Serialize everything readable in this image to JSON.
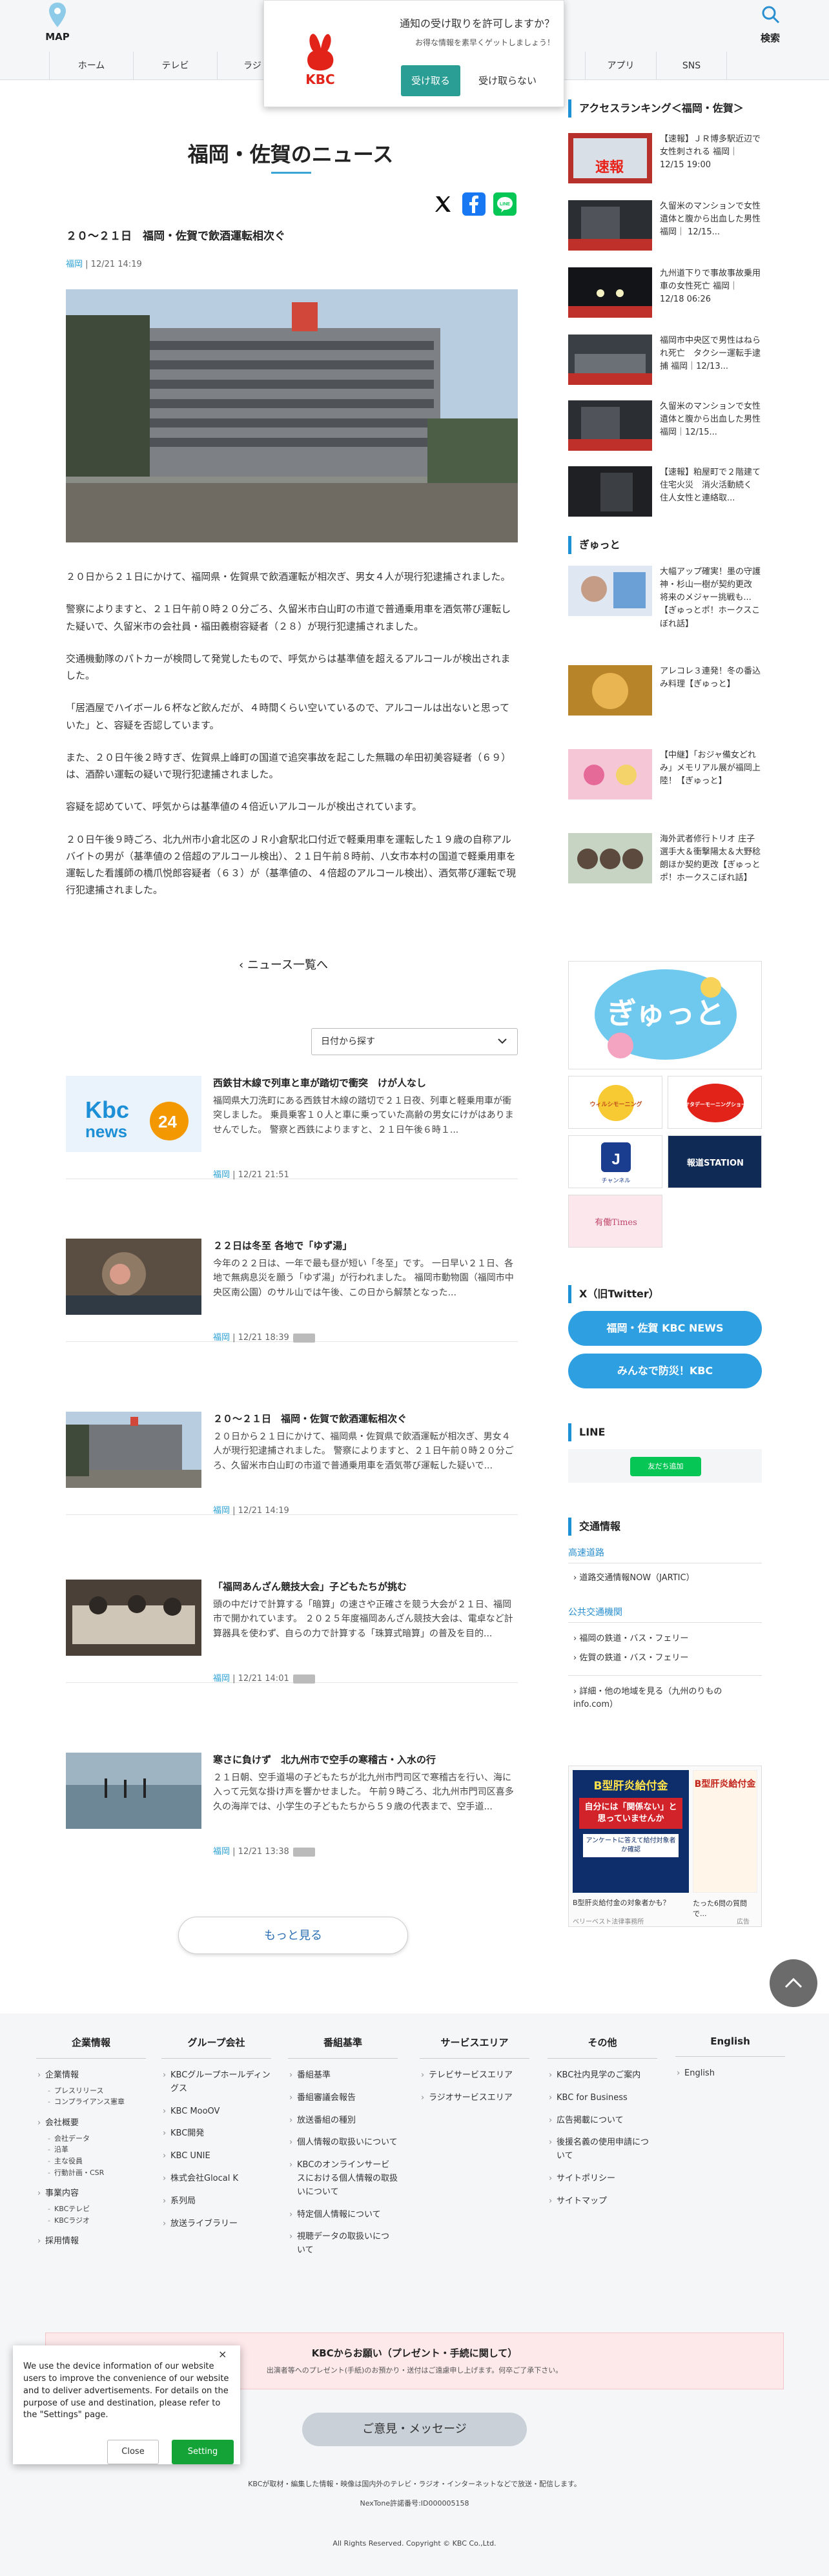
{
  "header": {
    "map_label": "MAP",
    "search_label": "検索",
    "nav": [
      "ホーム",
      "テレビ",
      "ラジ",
      "",
      "",
      "",
      "",
      "ベント",
      "アプリ",
      "SNS"
    ]
  },
  "notify": {
    "question": "通知の受け取りを許可しますか？",
    "sub": "お得な情報を素早くゲットしましょう！",
    "accept": "受け取る",
    "deny": "受け取らない",
    "logo_text": "KBC"
  },
  "main": {
    "section_title": "福岡・佐賀のニュース",
    "article": {
      "title": "２０～２１日　福岡・佐賀で飲酒運転相次ぐ",
      "tag": "福岡",
      "date": "12/21 14:19",
      "body": [
        "２０日から２１日にかけて、福岡県・佐賀県で飲酒運転が相次ぎ、男女４人が現行犯逮捕されました。",
        "警察によりますと、２１日午前０時２０分ごろ、久留米市白山町の市道で普通乗用車を酒気帯び運転した疑いで、久留米市の会社員・福田義樹容疑者（２８）が現行犯逮捕されました。",
        "交通機動隊のパトカーが検問して発覚したもので、呼気からは基準値を超えるアルコールが検出されました。",
        "「居酒屋でハイボール６杯など飲んだが、４時間くらい空いているので、アルコールは出ないと思っていた」と、容疑を否認しています。",
        "また、２０日午後２時すぎ、佐賀県上峰町の国道で追突事故を起こした無職の牟田初美容疑者（６９）は、酒酔い運転の疑いで現行犯逮捕されました。",
        "容疑を認めていて、呼気からは基準値の４倍近いアルコールが検出されています。",
        "２０日午後９時ごろ、北九州市小倉北区のＪＲ小倉駅北口付近で軽乗用車を運転した１９歳の自称アルバイトの男が（基準値の２倍超のアルコール検出）、２１日午前８時前、八女市本村の国道で軽乗用車を運転した看護師の橋爪悦郎容疑者（６３）が（基準値の、４倍超のアルコール検出）、酒気帯び運転で現行犯逮捕されました。"
      ]
    },
    "back_link": "ニュース一覧へ",
    "date_select": "日付から探す",
    "news_list": [
      {
        "title": "西鉄甘木線で列車と車が踏切で衝突　けが人なし",
        "excerpt": "福岡県大刀洗町にある西鉄甘木線の踏切で２１日夜、列車と軽乗用車が衝突しました。 乗員乗客１０人と車に乗っていた高齢の男女にけがはありませんでした。 警察と西鉄によりますと、２１日午後６時１...",
        "tag": "福岡",
        "date": "12/21 21:51",
        "video": false
      },
      {
        "title": "２２日は冬至 各地で「ゆず湯」",
        "excerpt": "今年の２２日は、一年で最も昼が短い「冬至」です。 一日早い２１日、各地で無病息災を願う「ゆず湯」が行われました。 福岡市動物園（福岡市中央区南公園）のサル山では午後、この日から解禁となった...",
        "tag": "福岡",
        "date": "12/21 18:39",
        "video": true
      },
      {
        "title": "２０～２１日　福岡・佐賀で飲酒運転相次ぐ",
        "excerpt": "２０日から２１日にかけて、福岡県・佐賀県で飲酒運転が相次ぎ、男女４人が現行犯逮捕されました。 警察によりますと、２１日午前０時２０分ごろ、久留米市白山町の市道で普通乗用車を酒気帯び運転した疑いで...",
        "tag": "福岡",
        "date": "12/21 14:19",
        "video": false
      },
      {
        "title": "「福岡あんざん競技大会」子どもたちが挑む",
        "excerpt": "頭の中だけで計算する「暗算」の速さや正確さを競う大会が２１日、福岡市で開かれています。 ２０２５年度福岡あんざん競技大会は、電卓など計算器具を使わず、自らの力で計算する「珠算式暗算」の普及を目的...",
        "tag": "福岡",
        "date": "12/21 14:01",
        "video": true
      },
      {
        "title": "寒さに負けず　北九州市で空手の寒稽古・入水の行",
        "excerpt": "２１日朝、空手道場の子どもたちが北九州市門司区で寒稽古を行い、海に入って元気な掛け声を響かせました。 午前９時ごろ、北九州市門司区喜多久の海岸では、小学生の子どもたちから５９歳の代表まで、空手道...",
        "tag": "福岡",
        "date": "12/21 13:38",
        "video": true
      }
    ],
    "more_label": "もっと見る"
  },
  "sidebar": {
    "ranking_title": "アクセスランキング＜福岡・佐賀＞",
    "ranking": [
      "【速報】ＪＲ博多駅近辺で女性刺される 福岡｜12/15 19:00",
      "久留米のマンションで女性遺体と腹から出血した男性 福岡｜ 12/15...",
      "九州道下りで事故事故乗用車の女性死亡 福岡｜ 12/18 06:26",
      "福岡市中央区で男性はねられ死亡　タクシー運転手逮捕 福岡｜12/13...",
      "久留米のマンションで女性遺体と腹から出血した男性 福岡｜12/15...",
      "【速報】粕屋町で２階建て住宅火災　消火活動続く　住人女性と連絡取..."
    ],
    "gyutto_title": "ぎゅっと",
    "gyutto": [
      "大幅アップ確実！墨の守護神・杉山一樹が契約更改　将来のメジャー挑戦も...【ぎゅっとポ！ホークスこぼれ話】",
      "アレコレ３連発！冬の番込み料理【ぎゅっと】",
      "【中継】「おジャ備女どれみ」メモリアル展が福岡上陸！【ぎゅっと】",
      "海外武者修行トリオ 庄子選手大＆衝撃陽太＆大野稔朗ほか契約更改【ぎゅっとポ！ホークスこぼれ話】"
    ],
    "banners": [
      "ぎゅっと",
      "ウィルシモーニング",
      "サタデーモーニングショー",
      "チャンネル",
      "報道STATION",
      "有働Times"
    ],
    "x_title": "X（旧Twitter）",
    "x_buttons": [
      "福岡・佐賀 KBC NEWS",
      "みんなで防災！KBC"
    ],
    "line_title": "LINE",
    "line_friend": "友だち追加",
    "traffic_title": "交通情報",
    "traffic": {
      "highway_label": "高速道路",
      "highway_links": [
        "道路交通情報NOW（JARTIC）"
      ],
      "public_label": "公共交通機関",
      "public_links": [
        "福岡の鉄道・バス・フェリー",
        "佐賀の鉄道・バス・フェリー"
      ],
      "detail_link": "詳細・他の地域を見る（九州のりものinfo.com）"
    },
    "ad": {
      "title": "B型肝炎給付金",
      "line1": "自分には「関係ない」と思っていませんか",
      "line2": "アンケートに答えて給付対象者か確認",
      "caption1": "B型肝炎給付金の対象者かも？",
      "caption2": "たった6問の質問で...",
      "source": "ベリーベスト法律事務所",
      "label": "広告"
    }
  },
  "footer": {
    "columns": [
      {
        "title": "企業情報",
        "items": [
          [
            "企業情報",
            [
              "プレスリリース",
              "コンプライアンス憲章"
            ]
          ],
          [
            "会社概要",
            [
              "会社データ",
              "沿革",
              "主な役員",
              "行動計画・CSR"
            ]
          ],
          [
            "事業内容",
            [
              "KBCテレビ",
              "KBCラジオ"
            ]
          ],
          [
            "採用情報",
            []
          ]
        ]
      },
      {
        "title": "グループ会社",
        "items": [
          [
            "KBCグループホールディングス",
            []
          ],
          [
            "KBC MooOV",
            []
          ],
          [
            "KBC開発",
            []
          ],
          [
            "KBC UNIE",
            []
          ],
          [
            "株式会社Glocal K",
            []
          ],
          [
            "系列局",
            []
          ],
          [
            "放送ライブラリー",
            []
          ]
        ]
      },
      {
        "title": "番組基準",
        "items": [
          [
            "番組基準",
            []
          ],
          [
            "番組審議会報告",
            []
          ],
          [
            "放送番組の種別",
            []
          ],
          [
            "個人情報の取扱いについて",
            []
          ],
          [
            "KBCのオンラインサービスにおける個人情報の取扱いについて",
            []
          ],
          [
            "特定個人情報について",
            []
          ],
          [
            "視聴データの取扱いについて",
            []
          ]
        ]
      },
      {
        "title": "サービスエリア",
        "items": [
          [
            "テレビサービスエリア",
            []
          ],
          [
            "ラジオサービスエリア",
            []
          ]
        ]
      },
      {
        "title": "その他",
        "items": [
          [
            "KBC社内見学のご案内",
            []
          ],
          [
            "KBC for Business",
            []
          ],
          [
            "広告掲載について",
            []
          ],
          [
            "後援名義の使用申請について",
            []
          ],
          [
            "サイトポリシー",
            []
          ],
          [
            "サイトマップ",
            []
          ]
        ]
      },
      {
        "title": "English",
        "items": [
          [
            "English",
            []
          ]
        ]
      }
    ],
    "notice_title": "KBCからお願い（プレゼント・手続に関して）",
    "notice_sub": "出演者等へのプレゼント(手紙)のお預かり・送付はご遠慮申し上げます。何卒ご了承下さい。",
    "opinion": "ご意見・メッセージ",
    "copyright_note": "KBCが取材・編集した情報・映像は国内外のテレビ・ラジオ・インターネットなどで放送・配信します。",
    "license": "NexTone許諾番号:ID000005158",
    "copyright": "All Rights Reserved. Copyright © KBC Co.,Ltd."
  },
  "cookie": {
    "text": "We use the device information of our website users to improve the convenience of our website and to deliver advertisements. For details on the purpose of use and destination, please refer to the \"Settings\" page.",
    "close": "Close",
    "setting": "Setting"
  },
  "colors": {
    "accent": "#2e9fe0",
    "teal": "#2a9d95",
    "line_green": "#06c755"
  }
}
